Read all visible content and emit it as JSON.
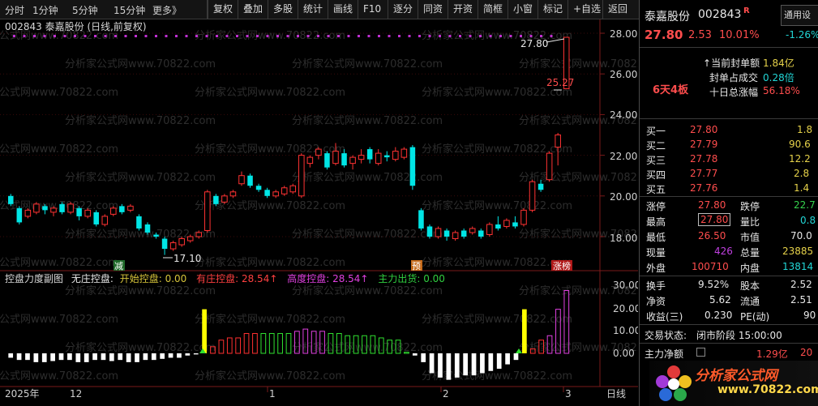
{
  "toolbar": {
    "periods": [
      "分时",
      "1分钟",
      "5分钟",
      "15分钟",
      "更多》"
    ],
    "buttons": [
      "复权",
      "叠加",
      "多股",
      "统计",
      "画线",
      "F10",
      "逐分",
      "同资",
      "开资",
      "简框",
      "小窗",
      "标记",
      "+自选",
      "返回"
    ]
  },
  "chart": {
    "title": "002843 泰嘉股份 (日线,前复权)",
    "y_ticks": [
      "28.00",
      "26.00",
      "24.00",
      "22.00",
      "20.00",
      "18.00"
    ],
    "high_label": "27.80",
    "prev_label": "25.27",
    "low_label": "17.10",
    "markers": {
      "jian": "减",
      "yu": "预",
      "zhangbang": "涨榜"
    },
    "watermark": "分析家公式网www.70822.com",
    "colors": {
      "up": "#ff3232",
      "down": "#00e5e5",
      "grid": "#3a0a0a",
      "axis": "#7a1a1a"
    }
  },
  "indicator": {
    "name": "控盘力度副图",
    "items": [
      {
        "label": "无庄控盘: ",
        "value": "",
        "color": "#e8e8e8"
      },
      {
        "label": "开始控盘: ",
        "value": "0.00",
        "color": "#d6c43a"
      },
      {
        "label": "有庄控盘: ",
        "value": "28.54↑",
        "color": "#ff4040"
      },
      {
        "label": "高度控盘: ",
        "value": "28.54↑",
        "color": "#e040e0"
      },
      {
        "label": "主力出货: ",
        "value": "0.00",
        "color": "#30d040"
      }
    ],
    "y_ticks": [
      "30.00",
      "20.00",
      "10.00",
      "0.00"
    ]
  },
  "xaxis": {
    "labels": [
      "2025年",
      "12",
      "1",
      "2",
      "3"
    ],
    "period": "日线"
  },
  "panel": {
    "stock_name": "泰嘉股份",
    "stock_code": "002843",
    "r_badge": "R",
    "price": "27.80",
    "change": "2.53",
    "pct": "10.01%",
    "notice_tab": "通用设",
    "side_pct": "-1.26%",
    "limit_stats": [
      {
        "label": "当前封单额",
        "value": "1.84亿"
      },
      {
        "label": "封单占成交",
        "value": "0.28倍"
      },
      {
        "label": "十日总涨幅",
        "value": "56.18%"
      }
    ],
    "boards": "6天4板",
    "bids": [
      {
        "label": "买一",
        "price": "27.80",
        "vol": "1.8"
      },
      {
        "label": "买二",
        "price": "27.79",
        "vol": "90.6"
      },
      {
        "label": "买三",
        "price": "27.78",
        "vol": "12.2"
      },
      {
        "label": "买四",
        "price": "27.77",
        "vol": "2.8"
      },
      {
        "label": "买五",
        "price": "27.76",
        "vol": "1.4"
      }
    ],
    "quote": [
      {
        "l1": "涨停",
        "v1": "27.80",
        "l2": "跌停",
        "v2": "22.7"
      },
      {
        "l1": "最高",
        "v1": "27.80",
        "l2": "量比",
        "v2": "0.8"
      },
      {
        "l1": "最低",
        "v1": "26.50",
        "l2": "市值",
        "v2": "70.0"
      },
      {
        "l1": "现量",
        "v1": "426",
        "l2": "总量",
        "v2": "23885"
      },
      {
        "l1": "外盘",
        "v1": "100710",
        "l2": "内盘",
        "v2": "13814"
      }
    ],
    "fund": [
      {
        "l1": "换手",
        "v1": "9.52%",
        "l2": "股本",
        "v2": "2.52"
      },
      {
        "l1": "净资",
        "v1": "5.62",
        "l2": "流通",
        "v2": "2.51"
      },
      {
        "l1": "收益(三)",
        "v1": "0.230",
        "l2": "PE(动)",
        "v2": "90"
      }
    ],
    "trade_status_label": "交易状态:",
    "trade_status_value": "闭市阶段 15:00:00",
    "main_net_label": "主力净额",
    "main_net_value": "1.29亿",
    "main_net_tail": "20",
    "logo_text": "分析家公式网",
    "logo_url": "www.70822.com"
  }
}
